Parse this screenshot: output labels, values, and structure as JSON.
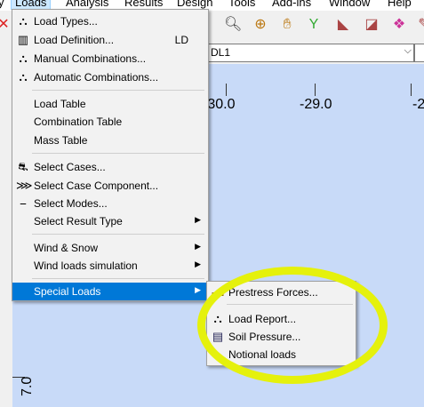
{
  "menubar": {
    "items": [
      "Loads",
      "Analysis",
      "Results",
      "Design",
      "Tools",
      "Add-ins",
      "Window",
      "Help"
    ]
  },
  "combo": {
    "value": "DL1"
  },
  "canvas": {
    "x_ticks": [
      "-30.0",
      "-29.0",
      "-2"
    ],
    "y_label": "7.0"
  },
  "loads_menu": {
    "items": [
      {
        "label": "Load Types...",
        "icon": "load-types-icon"
      },
      {
        "label": "Load Definition...",
        "shortcut": "LD",
        "icon": "load-definition-icon"
      },
      {
        "label": "Manual Combinations...",
        "icon": "manual-combinations-icon"
      },
      {
        "label": "Automatic Combinations...",
        "icon": "automatic-combinations-icon"
      },
      {
        "label": "Load Table"
      },
      {
        "label": "Combination Table"
      },
      {
        "label": "Mass Table"
      },
      {
        "label": "Select Cases...",
        "icon": "select-cases-icon"
      },
      {
        "label": "Select Case Component...",
        "icon": "select-component-icon"
      },
      {
        "label": "Select Modes...",
        "icon": "select-modes-icon"
      },
      {
        "label": "Select Result Type"
      },
      {
        "label": "Wind & Snow"
      },
      {
        "label": "Wind loads simulation"
      },
      {
        "label": "Special Loads"
      }
    ]
  },
  "special_loads_submenu": {
    "items": [
      {
        "label": "Prestress Forces...",
        "icon": "prestress-icon"
      },
      {
        "label": "Load Report...",
        "icon": "load-report-icon"
      },
      {
        "label": "Soil Pressure...",
        "icon": "soil-pressure-icon"
      },
      {
        "label": "Notional loads"
      }
    ]
  }
}
